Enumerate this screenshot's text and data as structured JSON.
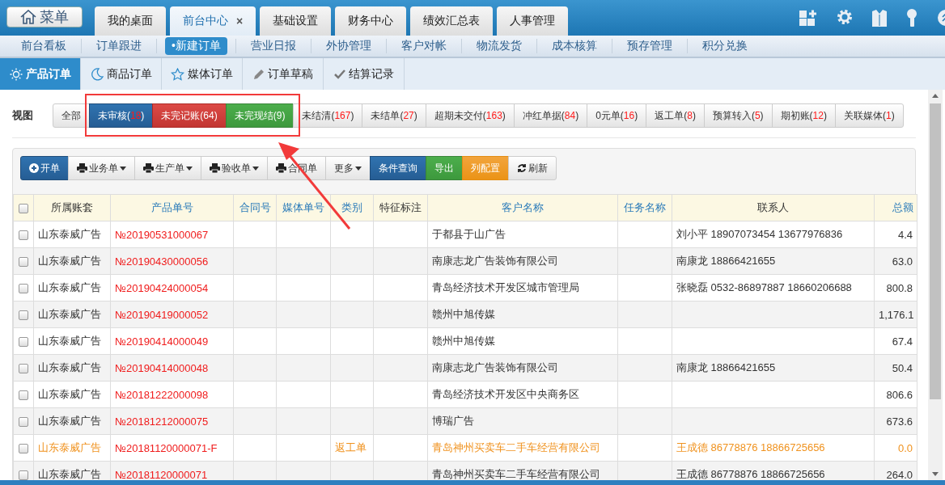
{
  "menu_button": {
    "label": "菜单"
  },
  "tabs": [
    {
      "label": "我的桌面",
      "selected": false,
      "closable": false
    },
    {
      "label": "前台中心",
      "selected": true,
      "closable": true,
      "close": "×"
    },
    {
      "label": "基础设置",
      "selected": false,
      "closable": false
    },
    {
      "label": "财务中心",
      "selected": false,
      "closable": false
    },
    {
      "label": "绩效汇总表",
      "selected": false,
      "closable": false
    },
    {
      "label": "人事管理",
      "selected": false,
      "closable": false
    }
  ],
  "nav": [
    {
      "label": "前台看板",
      "selected": false
    },
    {
      "label": "订单跟进",
      "selected": false
    },
    {
      "label": "•新建订单",
      "selected": true
    },
    {
      "label": "营业日报",
      "selected": false
    },
    {
      "label": "外协管理",
      "selected": false
    },
    {
      "label": "客户对帐",
      "selected": false
    },
    {
      "label": "物流发货",
      "selected": false
    },
    {
      "label": "成本核算",
      "selected": false
    },
    {
      "label": "预存管理",
      "selected": false
    },
    {
      "label": "积分兑换",
      "selected": false
    }
  ],
  "subtabs": [
    {
      "label": "产品订单",
      "selected": true
    },
    {
      "label": "商品订单",
      "selected": false
    },
    {
      "label": "媒体订单",
      "selected": false
    },
    {
      "label": "订单草稿",
      "selected": false
    },
    {
      "label": "结算记录",
      "selected": false
    }
  ],
  "view": {
    "label": "视图",
    "filters": [
      {
        "text": "全部",
        "kind": "default"
      },
      {
        "text": "未审核(",
        "count": "18",
        "close": ")",
        "kind": "primary",
        "count_red": true
      },
      {
        "text": "未完记账(",
        "count": "64",
        "close": ")",
        "kind": "danger",
        "count_red": false
      },
      {
        "text": "未完现结(",
        "count": "9",
        "close": ")",
        "kind": "success",
        "count_red": false
      },
      {
        "text": "未结清(",
        "count": "167",
        "close": ")",
        "kind": "default",
        "count_red": true
      },
      {
        "text": "未结单(",
        "count": "27",
        "close": ")",
        "kind": "default",
        "count_red": true
      },
      {
        "text": "超期未交付(",
        "count": "163",
        "close": ")",
        "kind": "default",
        "count_red": true
      },
      {
        "text": "冲红单据(",
        "count": "84",
        "close": ")",
        "kind": "default",
        "count_red": true
      },
      {
        "text": "0元单(",
        "count": "16",
        "close": ")",
        "kind": "default",
        "count_red": true
      },
      {
        "text": "返工单(",
        "count": "8",
        "close": ")",
        "kind": "default",
        "count_red": true
      },
      {
        "text": "预算转入(",
        "count": "5",
        "close": ")",
        "kind": "default",
        "count_red": true
      },
      {
        "text": "期初账(",
        "count": "12",
        "close": ")",
        "kind": "default",
        "count_red": true
      },
      {
        "text": "关联媒体(",
        "count": "1",
        "close": ")",
        "kind": "default",
        "count_red": true
      }
    ]
  },
  "toolbar": [
    {
      "label": "开单",
      "kind": "primary",
      "caret": false
    },
    {
      "label": "业务单",
      "kind": "default",
      "caret": true
    },
    {
      "label": "生产单",
      "kind": "default",
      "caret": true
    },
    {
      "label": "验收单",
      "kind": "default",
      "caret": true
    },
    {
      "label": "合同单",
      "kind": "default",
      "caret": false
    },
    {
      "label": "更多",
      "kind": "default",
      "caret": true
    },
    {
      "label": "条件查询",
      "kind": "primary",
      "caret": false
    },
    {
      "label": "导出",
      "kind": "success",
      "caret": false
    },
    {
      "label": "列配置",
      "kind": "warning",
      "caret": false
    },
    {
      "label": "刷新",
      "kind": "default",
      "caret": false
    }
  ],
  "table": {
    "select_all": {
      "checked": false
    },
    "columns": [
      {
        "label": "所属账套",
        "sortable": false
      },
      {
        "label": "产品单号",
        "sortable": true
      },
      {
        "label": "合同号",
        "sortable": true
      },
      {
        "label": "媒体单号",
        "sortable": true
      },
      {
        "label": "类别",
        "sortable": true
      },
      {
        "label": "特征标注",
        "sortable": false
      },
      {
        "label": "客户名称",
        "sortable": true
      },
      {
        "label": "任务名称",
        "sortable": true
      },
      {
        "label": "联系人",
        "sortable": false
      },
      {
        "label": "总额",
        "sortable": true
      }
    ],
    "rows": [
      {
        "kind": "normal",
        "checked": false,
        "cells": [
          "山东泰威广告",
          "№20190531000067",
          "",
          "",
          "",
          "",
          "于都县于山广告",
          "",
          "刘小平 18907073454 13677976836",
          "4.4"
        ]
      },
      {
        "kind": "normal",
        "checked": false,
        "cells": [
          "山东泰威广告",
          "№20190430000056",
          "",
          "",
          "",
          "",
          "南康志龙广告装饰有限公司",
          "",
          "南康龙 18866421655",
          "63.0"
        ]
      },
      {
        "kind": "normal",
        "checked": false,
        "cells": [
          "山东泰威广告",
          "№20190424000054",
          "",
          "",
          "",
          "",
          "青岛经济技术开发区城市管理局",
          "",
          "张晓磊 0532-86897887 18660206688",
          "800.8"
        ]
      },
      {
        "kind": "normal",
        "checked": false,
        "cells": [
          "山东泰威广告",
          "№20190419000052",
          "",
          "",
          "",
          "",
          "赣州中旭传媒",
          "",
          "",
          "1,176.1"
        ]
      },
      {
        "kind": "normal",
        "checked": false,
        "cells": [
          "山东泰威广告",
          "№20190414000049",
          "",
          "",
          "",
          "",
          "赣州中旭传媒",
          "",
          "",
          "67.4"
        ]
      },
      {
        "kind": "normal",
        "checked": false,
        "cells": [
          "山东泰威广告",
          "№20190414000048",
          "",
          "",
          "",
          "",
          "南康志龙广告装饰有限公司",
          "",
          "南康龙 18866421655",
          "50.4"
        ]
      },
      {
        "kind": "normal",
        "checked": false,
        "cells": [
          "山东泰威广告",
          "№20181222000098",
          "",
          "",
          "",
          "",
          "青岛经济技术开发区中央商务区",
          "",
          "",
          "806.6"
        ]
      },
      {
        "kind": "normal",
        "checked": false,
        "cells": [
          "山东泰威广告",
          "№20181212000075",
          "",
          "",
          "",
          "",
          "博瑞广告",
          "",
          "",
          "673.6"
        ]
      },
      {
        "kind": "rework",
        "checked": false,
        "cells": [
          "山东泰威广告",
          "№20181120000071-F",
          "",
          "",
          "返工单",
          "",
          "青岛神州买卖车二手车经营有限公司",
          "",
          "王成德 86778876 18866725656",
          "0.0"
        ]
      },
      {
        "kind": "normal",
        "checked": false,
        "cells": [
          "山东泰威广告",
          "№20181120000071",
          "",
          "",
          "",
          "",
          "青岛神州买卖车二手车经营有限公司",
          "",
          "王成德 86778876 18866725656",
          "264.0"
        ]
      }
    ]
  }
}
